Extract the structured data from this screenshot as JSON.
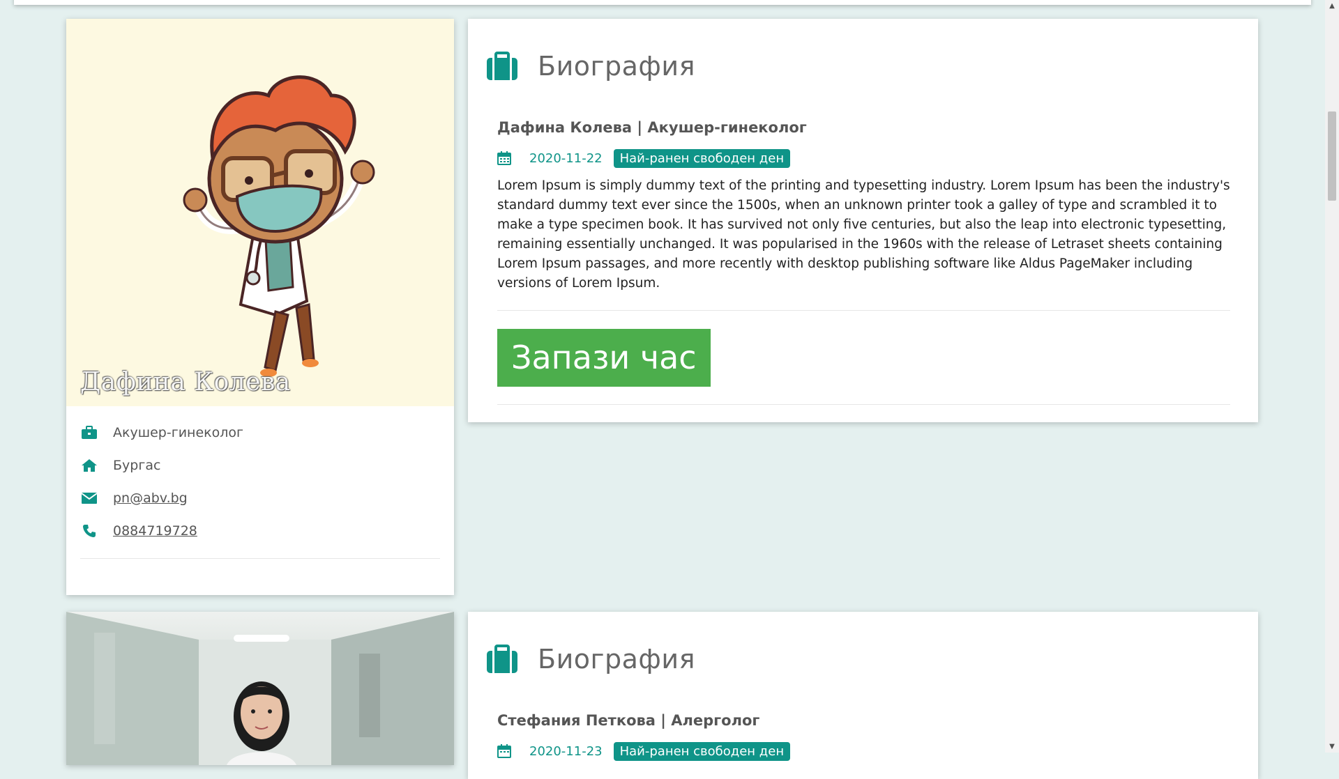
{
  "colors": {
    "teal": "#0f9488",
    "green_button": "#4cae4c",
    "page_bg": "#e4f0ef"
  },
  "doctors": [
    {
      "photo_name": "Дафина Колева",
      "photo_style": "cartoon-doctor-illustration",
      "specialty": "Акушер-гинеколог",
      "city": "Бургас",
      "email": "pn@abv.bg",
      "phone": "0884719728",
      "bio_title": "Биография",
      "bio_heading": "Дафина Колева | Акушер-гинеколог",
      "earliest_date": "2020-11-22",
      "badge": "Най-ранен свободен ден",
      "bio_text": "Lorem Ipsum is simply dummy text of the printing and typesetting industry. Lorem Ipsum has been the industry's standard dummy text ever since the 1500s, when an unknown printer took a galley of type and scrambled it to make a type specimen book. It has survived not only five centuries, but also the leap into electronic typesetting, remaining essentially unchanged. It was popularised in the 1960s with the release of Letraset sheets containing Lorem Ipsum passages, and more recently with desktop publishing software like Aldus PageMaker including versions of Lorem Ipsum.",
      "book_button": "Запази час"
    },
    {
      "photo_style": "doctor-photo-hospital-corridor",
      "bio_title": "Биография",
      "bio_heading": "Стефания Петкова | Алерголог",
      "earliest_date": "2020-11-23",
      "badge": "Най-ранен свободен ден"
    }
  ],
  "icons": {
    "specialty": "briefcase-icon",
    "city": "home-icon",
    "email": "envelope-icon",
    "phone": "phone-icon",
    "bio": "suitcase-icon",
    "date": "calendar-icon"
  }
}
